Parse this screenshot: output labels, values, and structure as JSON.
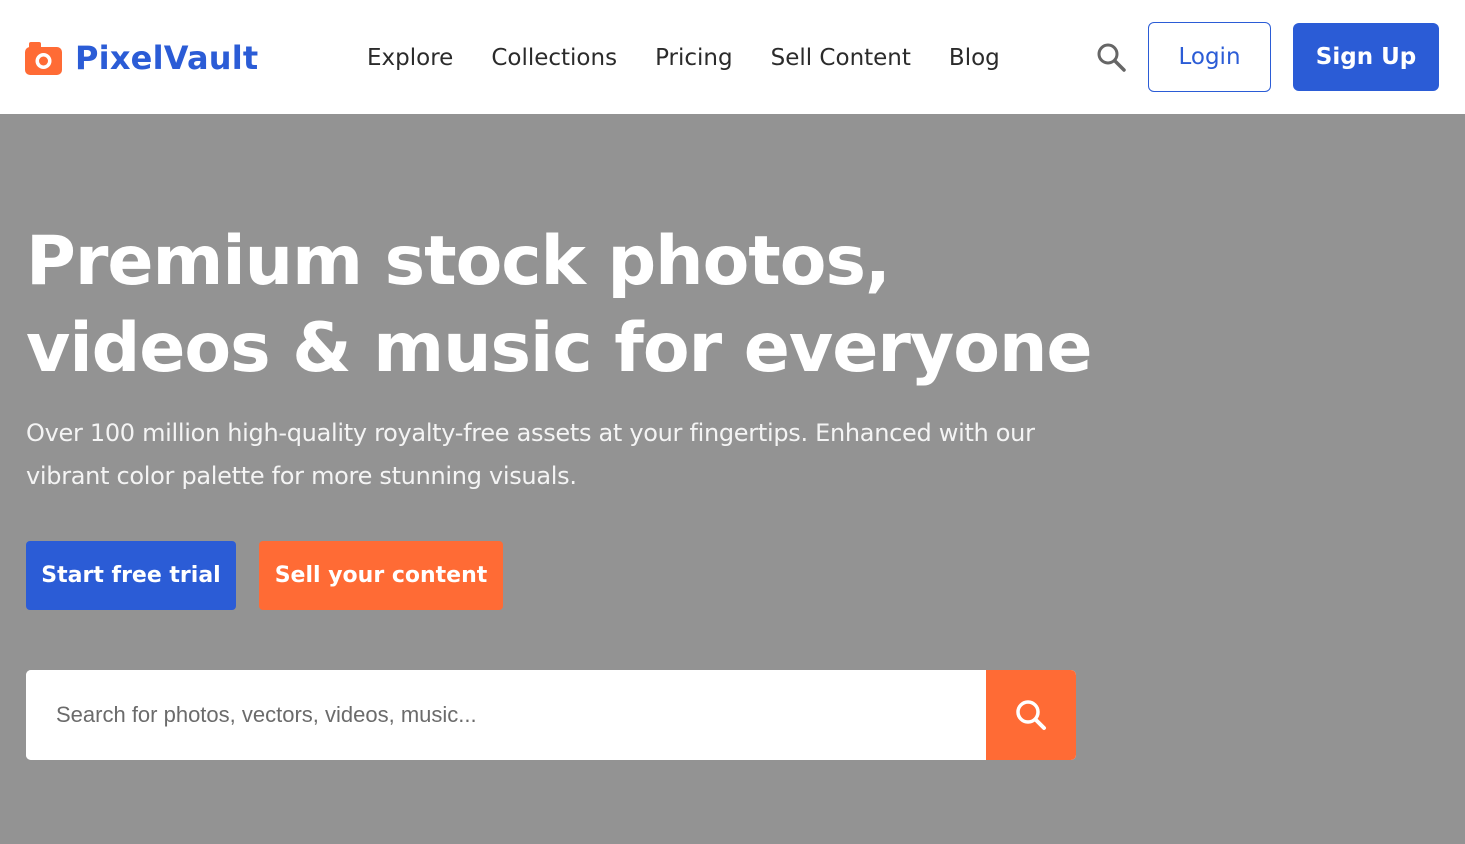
{
  "brand": {
    "name": "PixelVault",
    "icon": "camera-icon",
    "accent": "#ff6b35",
    "primary": "#2b5cd6"
  },
  "nav": {
    "items": [
      {
        "label": "Explore"
      },
      {
        "label": "Collections"
      },
      {
        "label": "Pricing"
      },
      {
        "label": "Sell Content"
      },
      {
        "label": "Blog"
      }
    ],
    "search_icon": "search-icon",
    "login_label": "Login",
    "signup_label": "Sign Up"
  },
  "hero": {
    "title": "Premium stock photos, videos & music for everyone",
    "subtitle": "Over 100 million high-quality royalty-free assets at your fingertips. Enhanced with our vibrant color palette for more stunning visuals.",
    "cta_primary": "Start free trial",
    "cta_secondary": "Sell your content",
    "search": {
      "placeholder": "Search for photos, vectors, videos, music...",
      "icon": "search-icon"
    }
  }
}
